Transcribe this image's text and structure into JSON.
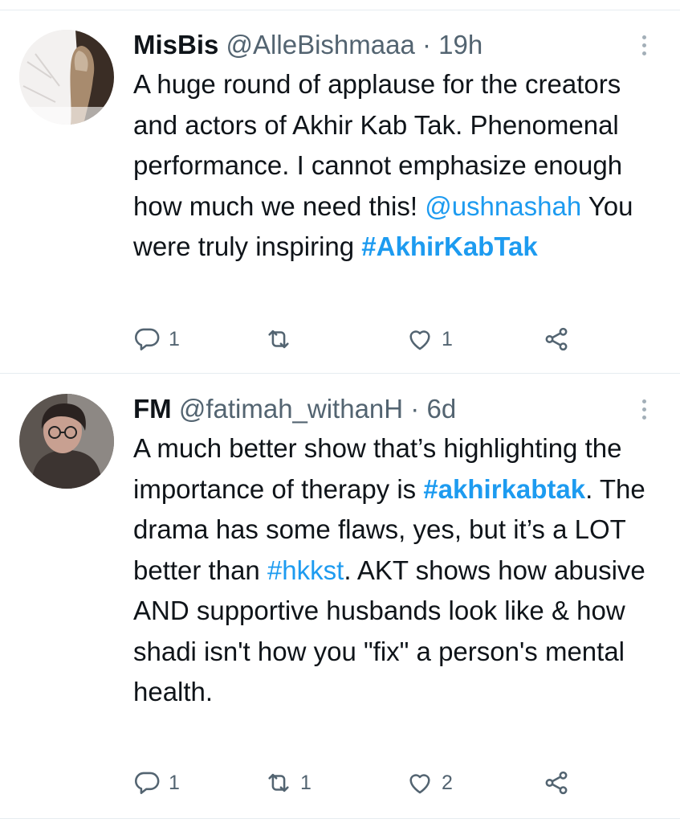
{
  "tweets": [
    {
      "name": "MisBis",
      "handle": "@AlleBishmaaa",
      "separator": "·",
      "time": "19h",
      "body": {
        "t1": "A huge round of applause for the creators and actors of Akhir Kab Tak. Phenomenal performance. I cannot emphasize enough how much we need this! ",
        "mention": "@ushnashah",
        "t2": " You were truly inspiring ",
        "hashtag": "#AkhirKabTak"
      },
      "replies": "1",
      "retweets": "",
      "likes": "1"
    },
    {
      "name": "FM",
      "handle": "@fatimah_withanH",
      "separator": "·",
      "time": "6d",
      "body": {
        "t1": "A much better show that’s highlighting the importance of therapy is ",
        "hashtag1": "#akhirkabtak",
        "t2": ". The drama has some flaws, yes, but it’s a LOT better than ",
        "hashtag2": "#hkkst",
        "t3": ". AKT shows how abusive AND supportive husbands look like & how shadi isn't how you \"fix\" a person's mental health."
      },
      "replies": "1",
      "retweets": "1",
      "likes": "2"
    }
  ],
  "icons": {
    "reply": "reply-icon",
    "retweet": "retweet-icon",
    "like": "heart-icon",
    "share": "share-icon",
    "more": "more-vertical-icon"
  },
  "colors": {
    "link": "#1d9bf0",
    "secondary_text": "#536471",
    "divider": "#e6ecf0"
  }
}
